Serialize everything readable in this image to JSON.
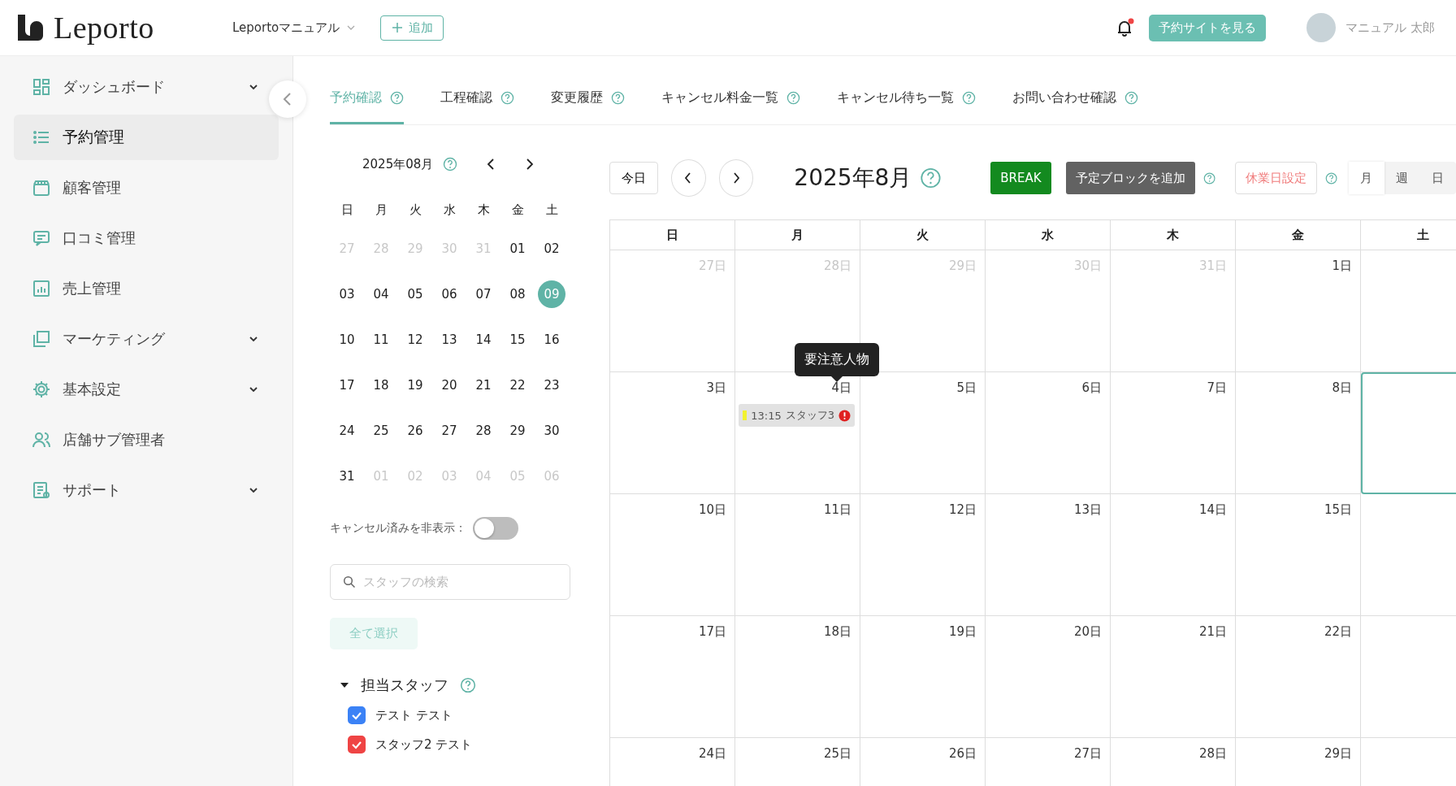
{
  "header": {
    "logo": "Leporto",
    "store_select": "Leportoマニュアル",
    "add_button": "追加",
    "notification_unread": true,
    "view_site_button": "予約サイトを見る",
    "user_name": "マニュアル 太郎"
  },
  "sidebar": {
    "items": [
      {
        "label": "ダッシュボード",
        "expandable": true,
        "selected": false
      },
      {
        "label": "予約管理",
        "expandable": false,
        "selected": true
      },
      {
        "label": "顧客管理",
        "expandable": false,
        "selected": false
      },
      {
        "label": "口コミ管理",
        "expandable": false,
        "selected": false
      },
      {
        "label": "売上管理",
        "expandable": false,
        "selected": false
      },
      {
        "label": "マーケティング",
        "expandable": true,
        "selected": false
      },
      {
        "label": "基本設定",
        "expandable": true,
        "selected": false
      },
      {
        "label": "店舗サブ管理者",
        "expandable": false,
        "selected": false
      },
      {
        "label": "サポート",
        "expandable": true,
        "selected": false
      }
    ]
  },
  "tabs": [
    {
      "label": "予約確認",
      "selected": true
    },
    {
      "label": "工程確認",
      "selected": false
    },
    {
      "label": "変更履歴",
      "selected": false
    },
    {
      "label": "キャンセル料金一覧",
      "selected": false
    },
    {
      "label": "キャンセル待ち一覧",
      "selected": false
    },
    {
      "label": "お問い合わせ確認",
      "selected": false
    }
  ],
  "mini_calendar": {
    "title": "2025年08月",
    "weekdays": [
      "日",
      "月",
      "火",
      "水",
      "木",
      "金",
      "土"
    ],
    "days": [
      {
        "label": "27",
        "in_month": false,
        "selected": false
      },
      {
        "label": "28",
        "in_month": false,
        "selected": false
      },
      {
        "label": "29",
        "in_month": false,
        "selected": false
      },
      {
        "label": "30",
        "in_month": false,
        "selected": false
      },
      {
        "label": "31",
        "in_month": false,
        "selected": false
      },
      {
        "label": "01",
        "in_month": true,
        "selected": false
      },
      {
        "label": "02",
        "in_month": true,
        "selected": false
      },
      {
        "label": "03",
        "in_month": true,
        "selected": false
      },
      {
        "label": "04",
        "in_month": true,
        "selected": false
      },
      {
        "label": "05",
        "in_month": true,
        "selected": false
      },
      {
        "label": "06",
        "in_month": true,
        "selected": false
      },
      {
        "label": "07",
        "in_month": true,
        "selected": false
      },
      {
        "label": "08",
        "in_month": true,
        "selected": false
      },
      {
        "label": "09",
        "in_month": true,
        "selected": true
      },
      {
        "label": "10",
        "in_month": true,
        "selected": false
      },
      {
        "label": "11",
        "in_month": true,
        "selected": false
      },
      {
        "label": "12",
        "in_month": true,
        "selected": false
      },
      {
        "label": "13",
        "in_month": true,
        "selected": false
      },
      {
        "label": "14",
        "in_month": true,
        "selected": false
      },
      {
        "label": "15",
        "in_month": true,
        "selected": false
      },
      {
        "label": "16",
        "in_month": true,
        "selected": false
      },
      {
        "label": "17",
        "in_month": true,
        "selected": false
      },
      {
        "label": "18",
        "in_month": true,
        "selected": false
      },
      {
        "label": "19",
        "in_month": true,
        "selected": false
      },
      {
        "label": "20",
        "in_month": true,
        "selected": false
      },
      {
        "label": "21",
        "in_month": true,
        "selected": false
      },
      {
        "label": "22",
        "in_month": true,
        "selected": false
      },
      {
        "label": "23",
        "in_month": true,
        "selected": false
      },
      {
        "label": "24",
        "in_month": true,
        "selected": false
      },
      {
        "label": "25",
        "in_month": true,
        "selected": false
      },
      {
        "label": "26",
        "in_month": true,
        "selected": false
      },
      {
        "label": "27",
        "in_month": true,
        "selected": false
      },
      {
        "label": "28",
        "in_month": true,
        "selected": false
      },
      {
        "label": "29",
        "in_month": true,
        "selected": false
      },
      {
        "label": "30",
        "in_month": true,
        "selected": false
      },
      {
        "label": "31",
        "in_month": true,
        "selected": false
      },
      {
        "label": "01",
        "in_month": false,
        "selected": false
      },
      {
        "label": "02",
        "in_month": false,
        "selected": false
      },
      {
        "label": "03",
        "in_month": false,
        "selected": false
      },
      {
        "label": "04",
        "in_month": false,
        "selected": false
      },
      {
        "label": "05",
        "in_month": false,
        "selected": false
      },
      {
        "label": "06",
        "in_month": false,
        "selected": false
      }
    ]
  },
  "hide_cancelled": {
    "label": "キャンセル済みを非表示：",
    "on": false
  },
  "staff_search": {
    "placeholder": "スタッフの検索"
  },
  "select_all_button": "全て選択",
  "staff_group": {
    "title": "担当スタッフ",
    "expanded": true,
    "staff": [
      {
        "name": "テスト テスト",
        "checked": true,
        "color": "#3b82f6"
      },
      {
        "name": "スタッフ2 テスト",
        "checked": true,
        "color": "#ef4444"
      }
    ]
  },
  "calendar": {
    "today_button": "今日",
    "title": "2025年8月",
    "break_button": "BREAK",
    "add_block_button": "予定ブロックを追加",
    "holiday_button": "休業日設定",
    "view_modes": [
      {
        "label": "月",
        "selected": true
      },
      {
        "label": "週",
        "selected": false
      },
      {
        "label": "日",
        "selected": false
      }
    ],
    "weekdays": [
      "日",
      "月",
      "火",
      "水",
      "木",
      "金",
      "土"
    ],
    "weeks": [
      [
        {
          "label": "27日",
          "in_month": false,
          "today": false
        },
        {
          "label": "28日",
          "in_month": false,
          "today": false
        },
        {
          "label": "29日",
          "in_month": false,
          "today": false
        },
        {
          "label": "30日",
          "in_month": false,
          "today": false
        },
        {
          "label": "31日",
          "in_month": false,
          "today": false
        },
        {
          "label": "1日",
          "in_month": true,
          "today": false
        },
        {
          "today": false
        }
      ],
      [
        {
          "label": "3日",
          "in_month": true,
          "today": false
        },
        {
          "label": "4日",
          "in_month": true,
          "today": false,
          "events": [
            {
              "time": "13:15",
              "staff": "スタッフ3",
              "color": "#f2f230",
              "flagged": true,
              "tooltip": "要注意人物"
            }
          ]
        },
        {
          "label": "5日",
          "in_month": true,
          "today": false
        },
        {
          "label": "6日",
          "in_month": true,
          "today": false
        },
        {
          "label": "7日",
          "in_month": true,
          "today": false
        },
        {
          "label": "8日",
          "in_month": true,
          "today": false
        },
        {
          "today": true
        }
      ],
      [
        {
          "label": "10日",
          "in_month": true,
          "today": false
        },
        {
          "label": "11日",
          "in_month": true,
          "today": false
        },
        {
          "label": "12日",
          "in_month": true,
          "today": false
        },
        {
          "label": "13日",
          "in_month": true,
          "today": false
        },
        {
          "label": "14日",
          "in_month": true,
          "today": false
        },
        {
          "label": "15日",
          "in_month": true,
          "today": false
        },
        {
          "today": false
        }
      ],
      [
        {
          "label": "17日",
          "in_month": true,
          "today": false
        },
        {
          "label": "18日",
          "in_month": true,
          "today": false
        },
        {
          "label": "19日",
          "in_month": true,
          "today": false
        },
        {
          "label": "20日",
          "in_month": true,
          "today": false
        },
        {
          "label": "21日",
          "in_month": true,
          "today": false
        },
        {
          "label": "22日",
          "in_month": true,
          "today": false
        },
        {
          "today": false
        }
      ],
      [
        {
          "label": "24日",
          "in_month": true,
          "today": false
        },
        {
          "label": "25日",
          "in_month": true,
          "today": false
        },
        {
          "label": "26日",
          "in_month": true,
          "today": false
        },
        {
          "label": "27日",
          "in_month": true,
          "today": false
        },
        {
          "label": "28日",
          "in_month": true,
          "today": false
        },
        {
          "label": "29日",
          "in_month": true,
          "today": false
        },
        {
          "today": false
        }
      ]
    ]
  }
}
